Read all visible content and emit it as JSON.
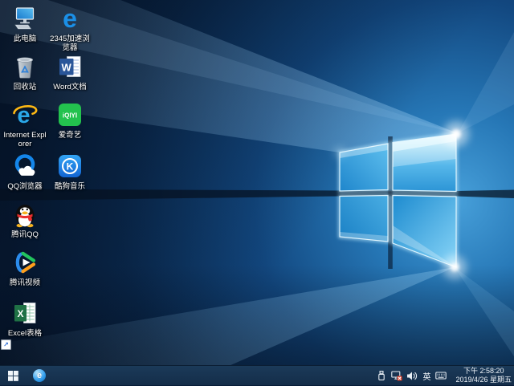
{
  "desktop": {
    "icons": [
      {
        "name": "this-pc",
        "label": "此电脑",
        "shortcut": false
      },
      {
        "name": "2345-browser",
        "label": "2345加速浏览器",
        "shortcut": true
      },
      {
        "name": "recycle-bin",
        "label": "回收站",
        "shortcut": false
      },
      {
        "name": "word-doc",
        "label": "Word文档",
        "shortcut": true
      },
      {
        "name": "internet-explorer",
        "label": "Internet Explorer",
        "shortcut": false
      },
      {
        "name": "iqiyi",
        "label": "爱奇艺",
        "shortcut": true,
        "logo_text": "iQIYI"
      },
      {
        "name": "qq-browser",
        "label": "QQ浏览器",
        "shortcut": true
      },
      {
        "name": "kugou-music",
        "label": "酷狗音乐",
        "shortcut": true,
        "logo_text": "K"
      },
      {
        "name": "tencent-qq",
        "label": "腾讯QQ",
        "shortcut": true
      },
      {
        "name": "tencent-video",
        "label": "腾讯视频",
        "shortcut": true
      },
      {
        "name": "excel",
        "label": "Excel表格",
        "shortcut": true,
        "logo_text": "X"
      }
    ],
    "shortcut_arrow_glyph": "↗"
  },
  "taskbar": {
    "pinned": [
      {
        "name": "browser-e",
        "glyph": "e"
      }
    ],
    "tray": {
      "icons": [
        "usb-device",
        "network-disconnected",
        "volume",
        "ime-indicator",
        "touch-keyboard"
      ],
      "ime": "英"
    },
    "clock": {
      "time": "下午 2:58:20",
      "date": "2019/4/26 星期五"
    }
  },
  "colors": {
    "wallpaper_bright": "#47a0da",
    "wallpaper_dark": "#071c38",
    "taskbar": "#16324e",
    "word_blue": "#2a5699",
    "excel_green": "#1f7145",
    "iqiyi_green": "#23c24e",
    "kugou_blue": "#1a7de4",
    "qqbrowser_blue": "#1486ea",
    "ie_blue": "#2aa7e8",
    "ie_swoosh_yellow": "#fdb813"
  }
}
